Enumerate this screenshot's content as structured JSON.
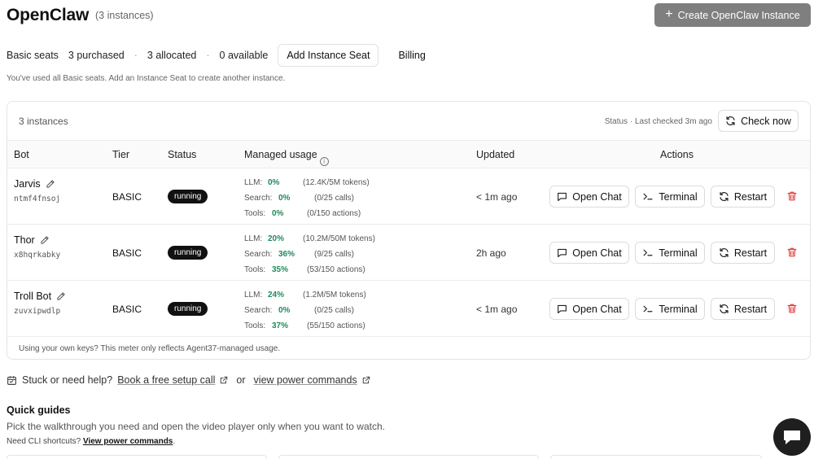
{
  "header": {
    "title": "OpenClaw",
    "instance_count": "(3 instances)",
    "create_button": "Create OpenClaw Instance"
  },
  "seats": {
    "label": "Basic seats",
    "purchased": "3 purchased",
    "allocated": "3 allocated",
    "available": "0 available",
    "separator": "·",
    "add_button": "Add Instance Seat",
    "billing": "Billing",
    "note": "You've used all Basic seats. Add an Instance Seat to create another instance."
  },
  "card": {
    "count": "3 instances",
    "status_note": "Status · Last checked 3m ago",
    "check_button": "Check now",
    "footer": "Using your own keys? This meter only reflects Agent37-managed usage."
  },
  "table": {
    "columns": {
      "bot": "Bot",
      "tier": "Tier",
      "status": "Status",
      "usage": "Managed usage",
      "updated": "Updated",
      "actions": "Actions"
    },
    "usage_labels": {
      "llm": "LLM:",
      "search": "Search:",
      "tools": "Tools:"
    },
    "action_labels": {
      "chat": "Open Chat",
      "terminal": "Terminal",
      "restart": "Restart"
    },
    "rows": [
      {
        "name": "Jarvis",
        "id": "ntmf4fnsoj",
        "tier": "BASIC",
        "status": "running",
        "llm_pct": "0%",
        "llm_detail": "(12.4K/5M tokens)",
        "search_pct": "0%",
        "search_detail": "(0/25 calls)",
        "tools_pct": "0%",
        "tools_detail": "(0/150 actions)",
        "updated": "< 1m ago"
      },
      {
        "name": "Thor",
        "id": "x8hqrkabky",
        "tier": "BASIC",
        "status": "running",
        "llm_pct": "20%",
        "llm_detail": "(10.2M/50M tokens)",
        "search_pct": "36%",
        "search_detail": "(9/25 calls)",
        "tools_pct": "35%",
        "tools_detail": "(53/150 actions)",
        "updated": "2h ago"
      },
      {
        "name": "Troll Bot",
        "id": "zuvxipwdlp",
        "tier": "BASIC",
        "status": "running",
        "llm_pct": "24%",
        "llm_detail": "(1.2M/5M tokens)",
        "search_pct": "0%",
        "search_detail": "(0/25 calls)",
        "tools_pct": "37%",
        "tools_detail": "(55/150 actions)",
        "updated": "< 1m ago"
      }
    ]
  },
  "help": {
    "prefix": "Stuck or need help?",
    "setup_link": "Book a free setup call",
    "or": "or",
    "power_link": "view power commands"
  },
  "guides": {
    "title": "Quick guides",
    "subtitle": "Pick the walkthrough you need and open the video player only when you want to watch.",
    "cli_prefix": "Need CLI shortcuts?",
    "cli_link": "View power commands",
    "cli_suffix": "."
  },
  "colors": {
    "accent_green": "#1f8a5b",
    "danger_red": "#e0413e",
    "create_button_bg": "#7f7f7f",
    "status_pill_bg": "#111111"
  }
}
